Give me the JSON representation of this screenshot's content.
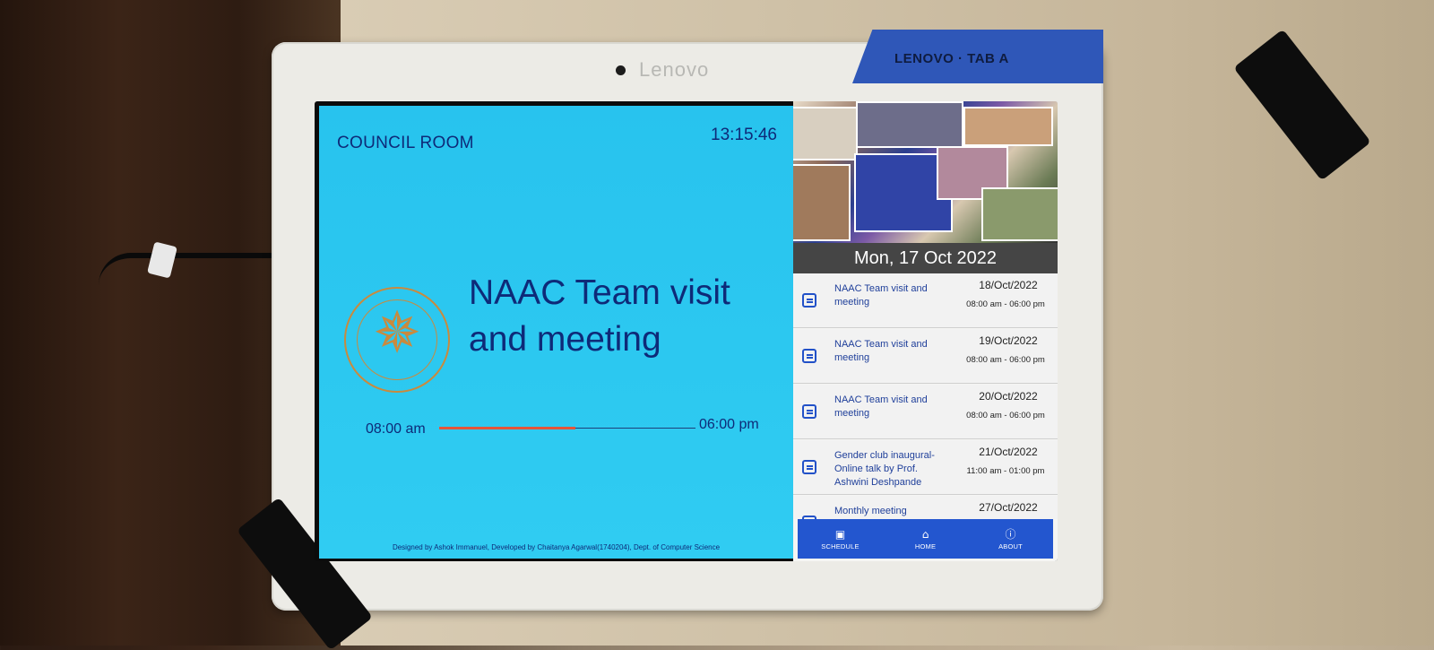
{
  "device": {
    "brand": "Lenovo",
    "sticker": "LENOVO · TAB A"
  },
  "main": {
    "room_name": "COUNCIL ROOM",
    "clock": "13:15:46",
    "event_title": "NAAC Team visit and meeting",
    "start_time": "08:00 am",
    "end_time": "06:00 pm",
    "progress_fraction": 0.53,
    "credit": "Designed by Ashok Immanuel, Developed by Chaitanya Agarwal(1740204), Dept. of Computer Science",
    "seal_icon": "college-seal-icon"
  },
  "sidebar": {
    "current_date": "Mon, 17 Oct 2022",
    "schedule": [
      {
        "title": "NAAC Team visit and meeting",
        "date": "18/Oct/2022",
        "time": "08:00 am - 06:00 pm"
      },
      {
        "title": "NAAC Team visit and meeting",
        "date": "19/Oct/2022",
        "time": "08:00 am - 06:00 pm"
      },
      {
        "title": "NAAC Team visit and meeting",
        "date": "20/Oct/2022",
        "time": "08:00 am - 06:00 pm"
      },
      {
        "title": "Gender club inaugural-Online talk by Prof. Ashwini Deshpande",
        "date": "21/Oct/2022",
        "time": "11:00 am - 01:00 pm"
      },
      {
        "title": "Monthly meeting (SANGAMA),",
        "date": "27/Oct/2022",
        "time": ""
      }
    ]
  },
  "nav": {
    "schedule_label": "SCHEDULE",
    "home_label": "HOME",
    "about_label": "ABOUT"
  },
  "colors": {
    "main_background": "#2cc8f0",
    "text_dark_blue": "#0e2a78",
    "progress_red": "#e4553a",
    "nav_blue": "#2356cf",
    "date_bar": "#454545"
  }
}
